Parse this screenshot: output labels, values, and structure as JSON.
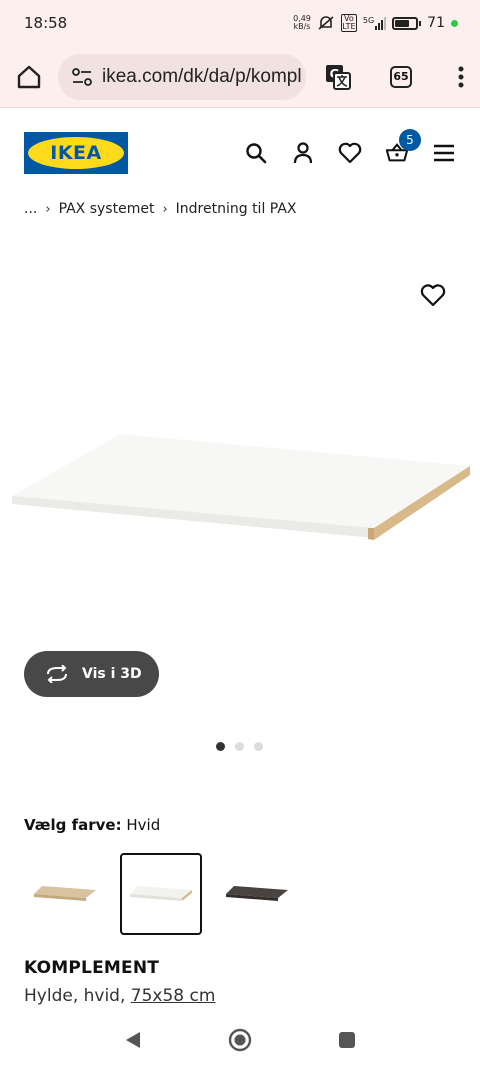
{
  "status_bar": {
    "time": "18:58",
    "net_speed_value": "0,49",
    "net_speed_unit": "kB/s",
    "volte": "Vo LTE",
    "signal": "5G",
    "battery": "71",
    "battery_level": 0.71
  },
  "browser": {
    "url": "ikea.com/dk/da/p/kompl",
    "tab_count": "65"
  },
  "header": {
    "logo_text": "IKEA",
    "cart_count": "5",
    "brand_blue": "#0058a3",
    "brand_yellow": "#ffda1a"
  },
  "breadcrumb": {
    "ellipsis": "...",
    "items": [
      "PAX systemet",
      "Indretning til PAX"
    ]
  },
  "gallery": {
    "view_3d_label": "Vis i 3D",
    "dots_total": 3,
    "active_dot": 0
  },
  "color_selector": {
    "label": "Vælg farve:",
    "selected": "Hvid",
    "swatches": [
      "oak",
      "white",
      "dark-brown"
    ]
  },
  "product": {
    "name": "KOMPLEMENT",
    "desc_prefix": "Hylde, hvid, ",
    "size": "75x58 cm"
  }
}
